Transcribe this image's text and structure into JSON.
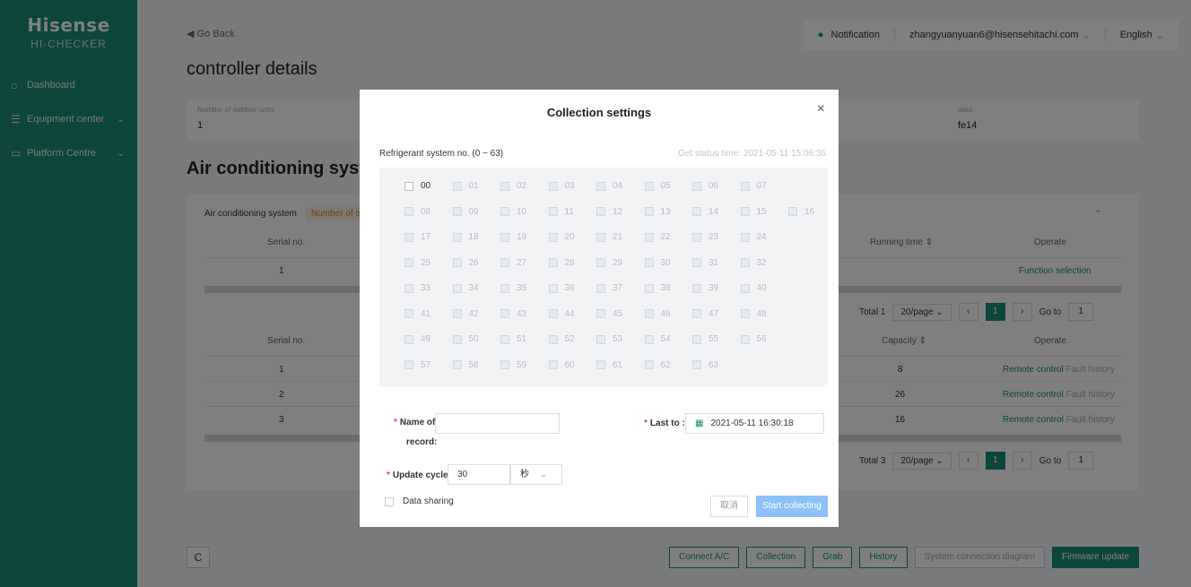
{
  "sidebar": {
    "brand": "Hisense",
    "brand_sub": "HI-CHECKER",
    "collapse_icon": "»",
    "items": [
      {
        "label": "Dashboard",
        "icon": "home-icon"
      },
      {
        "label": "Equipment center",
        "icon": "list-icon"
      },
      {
        "label": "Platform Centre",
        "icon": "monitor-icon"
      }
    ]
  },
  "header": {
    "go_back": "Go Back",
    "page_title": "controller details",
    "notification": "Notification",
    "user": "zhangyuanyuan6@hisensehitachi.com",
    "language": "English"
  },
  "info": {
    "outdoor_label": "Number of outdoor units",
    "outdoor_value": "1",
    "alias_label": "alias",
    "alias_value": "fe14"
  },
  "section_title": "Air conditioning system",
  "system_table": {
    "header_label": "Air conditioning system",
    "tag": "Number of outdoor",
    "col_serial": "Serial no.",
    "col_running": "Running time ⇕",
    "col_operate": "Operate",
    "row_serial": "1",
    "row_action": "Function selection",
    "total": "Total 1",
    "page_size": "20/page",
    "page": "1",
    "goto_label": "Go to",
    "goto_value": "1"
  },
  "indoor_table": {
    "col_serial": "Serial no.",
    "col_capacity": "Capacity ⇕",
    "col_operate": "Operate",
    "rows": [
      {
        "serial": "1",
        "capacity": "8",
        "action1": "Remote control",
        "action2": "Fault history"
      },
      {
        "serial": "2",
        "capacity": "26",
        "action1": "Remote control",
        "action2": "Fault history"
      },
      {
        "serial": "3",
        "capacity": "16",
        "action1": "Remote control",
        "action2": "Fault history"
      }
    ],
    "total": "Total 3",
    "page_size": "20/page",
    "page": "1",
    "goto_label": "Go to",
    "goto_value": "1"
  },
  "bottom_buttons": {
    "refresh": "C",
    "connect": "Connect A/C",
    "collection": "Collection",
    "grab": "Grab",
    "history": "History",
    "diagram": "System connection diagram",
    "firmware": "Firmware update"
  },
  "modal": {
    "title": "Collection settings",
    "close": "×",
    "refrigerant_label": "Refrigerant system no. (0 ~ 63)",
    "status_time": "Get status time: 2021-05-11 15:06:36",
    "numbers": [
      "00",
      "01",
      "02",
      "03",
      "04",
      "05",
      "06",
      "07",
      "08",
      "09",
      "10",
      "11",
      "12",
      "13",
      "14",
      "15",
      "16",
      "17",
      "18",
      "19",
      "20",
      "21",
      "22",
      "23",
      "24",
      "25",
      "26",
      "27",
      "28",
      "29",
      "30",
      "31",
      "32",
      "33",
      "34",
      "35",
      "36",
      "37",
      "38",
      "39",
      "40",
      "41",
      "42",
      "43",
      "44",
      "45",
      "46",
      "47",
      "48",
      "49",
      "50",
      "51",
      "52",
      "53",
      "54",
      "55",
      "56",
      "57",
      "58",
      "59",
      "60",
      "61",
      "62",
      "63"
    ],
    "name_label_1": "Name of",
    "name_label_2": "record:",
    "name_value": "",
    "last_to_label": "Last to :",
    "last_to_value": "2021-05-11 16:30:18",
    "update_label": "Update cycle:",
    "update_value": "30",
    "update_unit": "秒",
    "data_sharing": "Data sharing",
    "cancel": "取消",
    "start": "Start collecting"
  }
}
